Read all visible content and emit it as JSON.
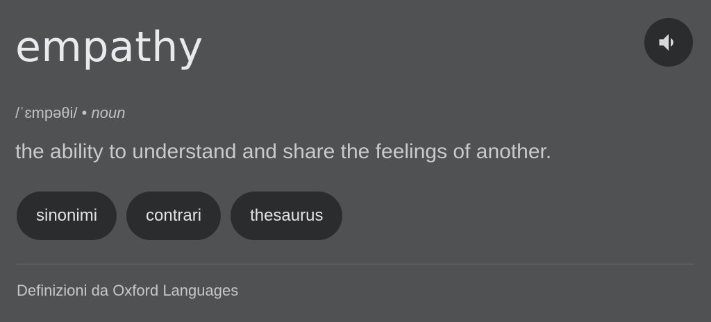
{
  "entry": {
    "word": "empathy",
    "pronunciation": "/ˈɛmpəθi/",
    "separator": " • ",
    "part_of_speech": "noun",
    "definition": "the ability to understand and share the feelings of another."
  },
  "audio": {
    "icon": "speaker-icon"
  },
  "chips": [
    {
      "label": "sinonimi"
    },
    {
      "label": "contrari"
    },
    {
      "label": "thesaurus"
    }
  ],
  "footer": {
    "source": "Definizioni da Oxford Languages"
  },
  "colors": {
    "background": "#505153",
    "chip_background": "#2b2c2e",
    "word_text": "#e8eaed",
    "secondary_text": "#c0c2c5"
  }
}
